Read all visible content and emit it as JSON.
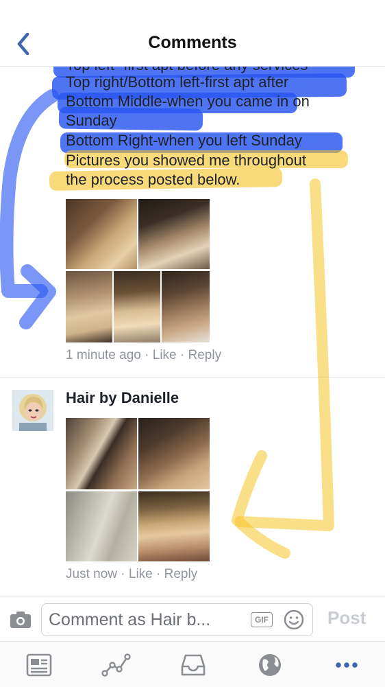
{
  "header": {
    "title": "Comments",
    "back_icon": "chevron-left-icon"
  },
  "first_comment": {
    "lines": [
      "Top left- first apt before any services",
      "Top right/Bottom left-first apt after",
      "Bottom Middle-when you came in on",
      "Sunday",
      "Bottom Right-when you left Sunday",
      "Pictures you showed me throughout",
      "the process posted below."
    ],
    "time": "1 minute ago",
    "like_label": "Like",
    "reply_label": "Reply",
    "separator": "·"
  },
  "second_comment": {
    "author": "Hair by Danielle",
    "time": "Just now",
    "like_label": "Like",
    "reply_label": "Reply",
    "separator": "·"
  },
  "composer": {
    "placeholder": "Comment as Hair b...",
    "gif_label": "GIF",
    "post_label": "Post",
    "camera_icon": "camera-icon",
    "emoji_icon": "emoji-icon"
  },
  "tabbar": {
    "items": [
      "news-feed-icon",
      "activity-icon",
      "inbox-icon",
      "globe-icon",
      "more-icon"
    ],
    "active_color": "#4267b2"
  },
  "colors": {
    "accent": "#4267b2",
    "blue_highlight": "#2855f0",
    "yellow_highlight": "#f6c428"
  }
}
